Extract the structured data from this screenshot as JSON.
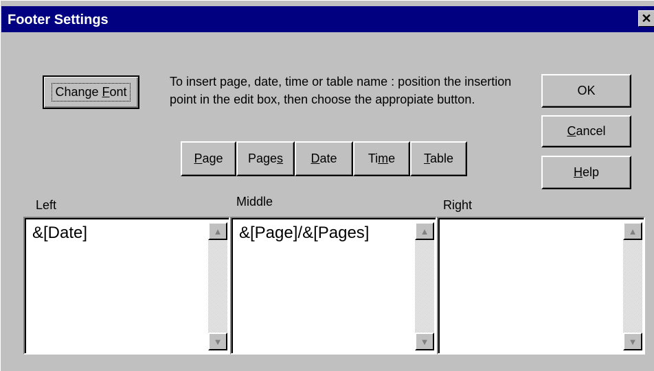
{
  "dialog": {
    "title": "Footer Settings",
    "close_label": "✕"
  },
  "buttons": {
    "change_font": {
      "pre": "Change ",
      "accel": "F",
      "post": "ont"
    },
    "ok": "OK",
    "cancel": {
      "accel": "C",
      "post": "ancel"
    },
    "help": {
      "accel": "H",
      "post": "elp"
    }
  },
  "instructions": "To insert page, date, time or table name : position the insertion point in the edit box, then choose the appropiate button.",
  "insert_buttons": {
    "page": {
      "pre": "",
      "accel": "P",
      "post": "age"
    },
    "pages": {
      "pre": "Page",
      "accel": "s",
      "post": ""
    },
    "date": {
      "pre": "",
      "accel": "D",
      "post": "ate"
    },
    "time": {
      "pre": "Ti",
      "accel": "m",
      "post": "e"
    },
    "table": {
      "pre": "",
      "accel": "T",
      "post": "able"
    }
  },
  "sections": {
    "left": {
      "label": "Left",
      "value": "&[Date]"
    },
    "middle": {
      "label": "Middle",
      "value": "&[Page]/&[Pages]"
    },
    "right": {
      "label": "Right",
      "value": ""
    }
  },
  "icons": {
    "scroll_up": "scroll-up-arrow-icon",
    "scroll_down": "scroll-down-arrow-icon",
    "close": "close-x-icon"
  },
  "colors": {
    "titlebar": "#000080",
    "face": "#c0c0c0"
  }
}
